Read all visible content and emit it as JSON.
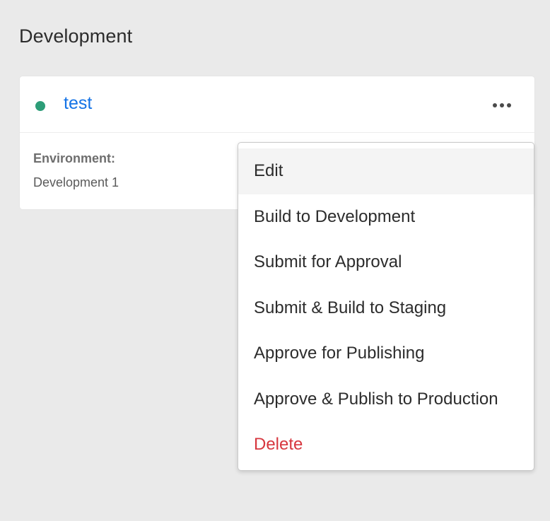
{
  "section": {
    "title": "Development"
  },
  "card": {
    "status_color": "#2d9d78",
    "name": "test",
    "more_icon": "ellipsis-icon",
    "environment_label": "Environment:",
    "environment_value": "Development 1"
  },
  "menu": {
    "items": [
      {
        "label": "Edit",
        "highlighted": true
      },
      {
        "label": "Build to Development"
      },
      {
        "label": "Submit for Approval"
      },
      {
        "label": "Submit & Build to Staging"
      },
      {
        "label": "Approve for Publishing"
      },
      {
        "label": "Approve & Publish to Production"
      },
      {
        "label": "Delete",
        "danger": true,
        "color": "#d7373f"
      }
    ]
  }
}
